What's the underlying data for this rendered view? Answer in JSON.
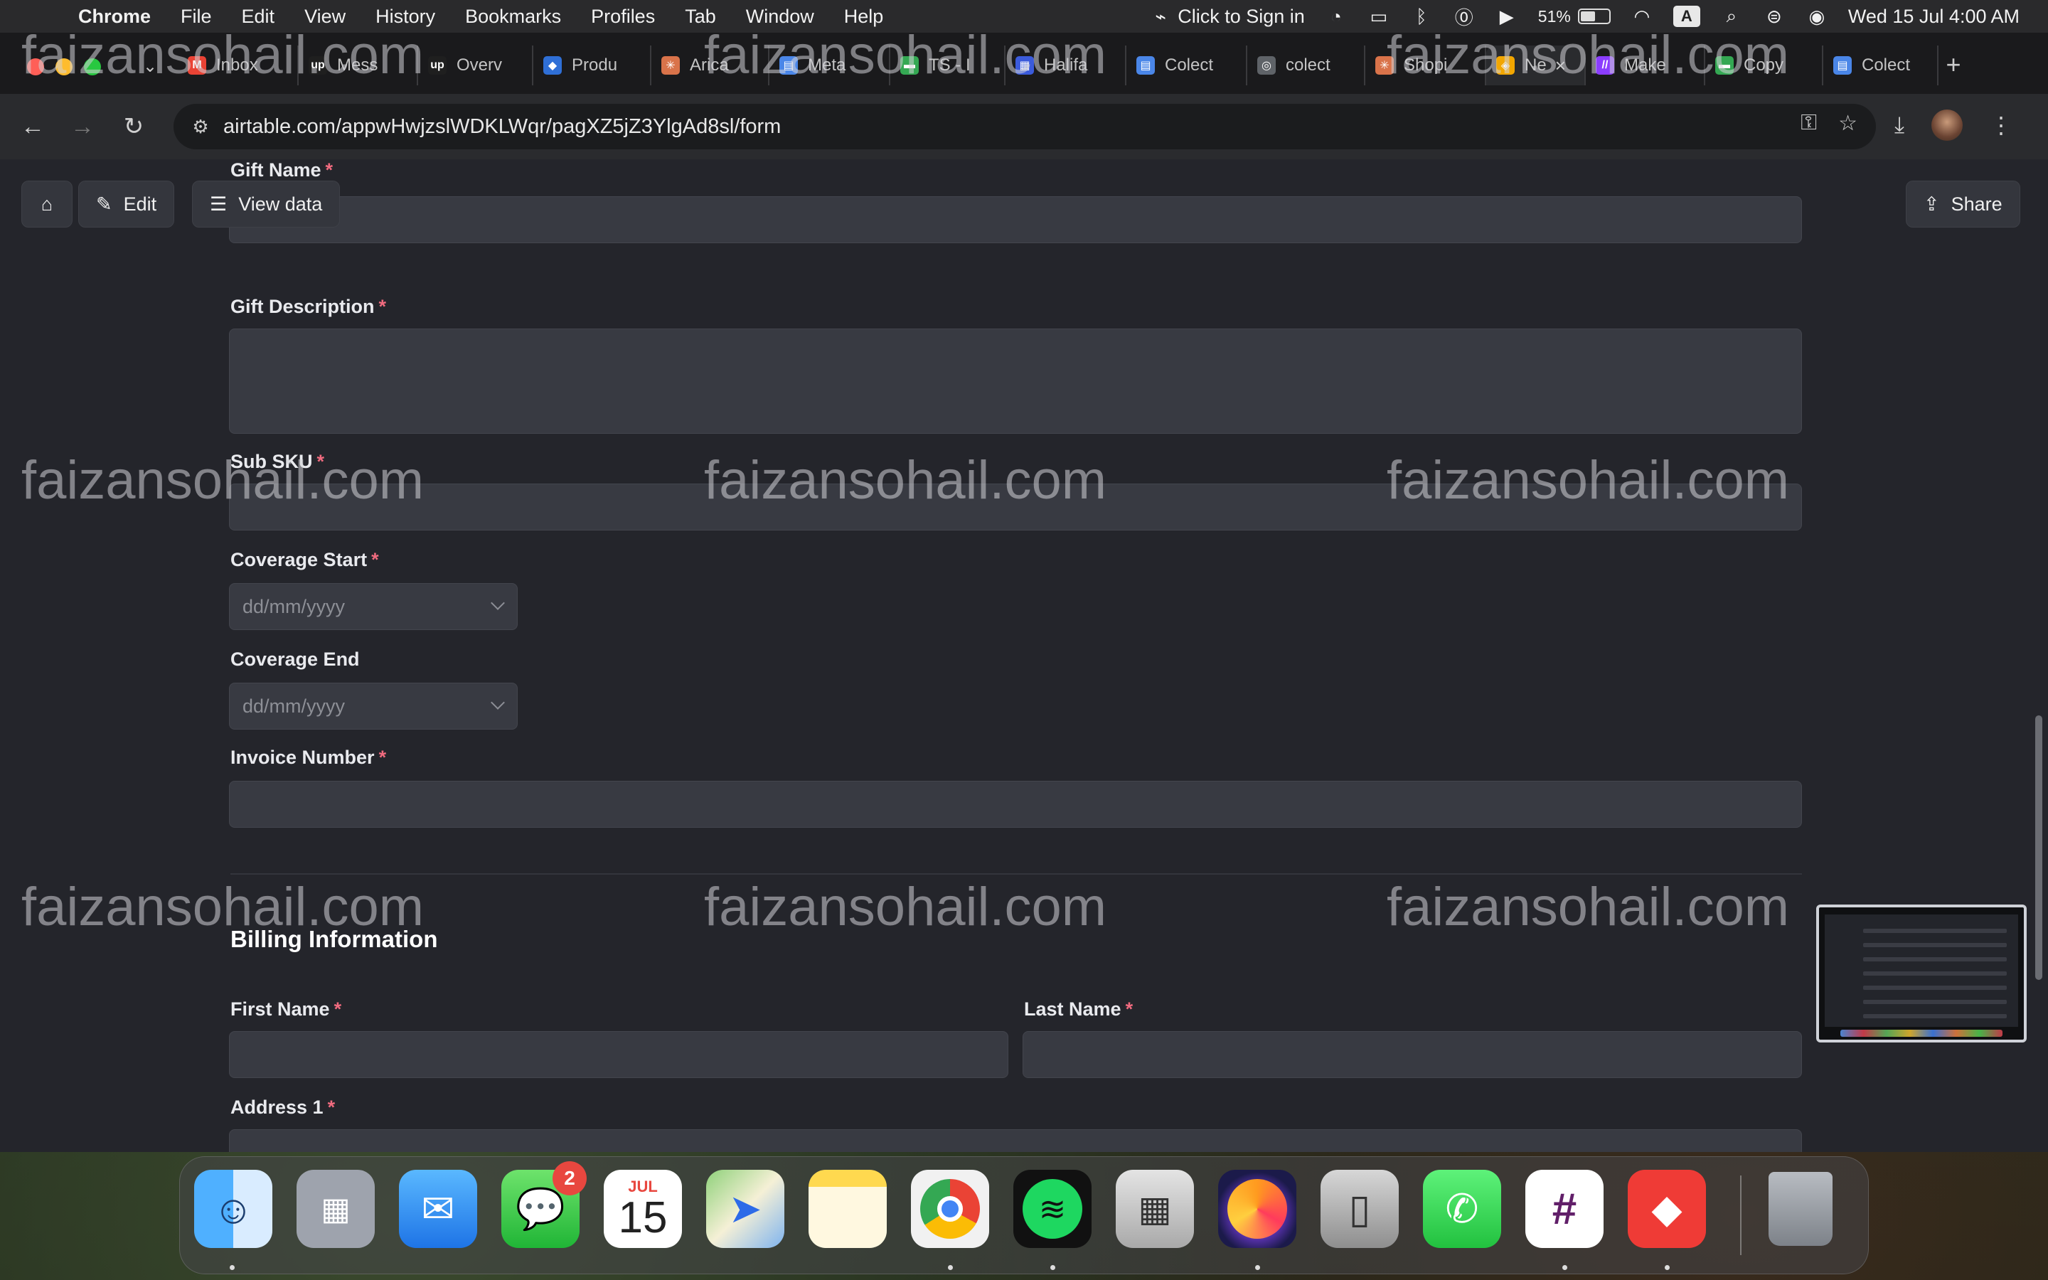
{
  "menubar": {
    "app_name": "Chrome",
    "menus": [
      "File",
      "Edit",
      "View",
      "History",
      "Bookmarks",
      "Profiles",
      "Tab",
      "Window",
      "Help"
    ],
    "sign_in": "Click to Sign in",
    "battery": "51%",
    "input_source": "A",
    "datetime": "Wed 15 Jul  4:00 AM"
  },
  "browser": {
    "tabs": [
      {
        "label": "Inbox",
        "fav": "M",
        "color": "#ea4335"
      },
      {
        "label": "Mess",
        "fav": "up",
        "color": "#1f1f1f"
      },
      {
        "label": "Overv",
        "fav": "up",
        "color": "#1f1f1f"
      },
      {
        "label": "Produ",
        "fav": "◆",
        "color": "#2f6fd6"
      },
      {
        "label": "Arica",
        "fav": "✳",
        "color": "#d9734a"
      },
      {
        "label": "Meta",
        "fav": "▤",
        "color": "#4a86e8"
      },
      {
        "label": "TS - I",
        "fav": "▬",
        "color": "#34a853"
      },
      {
        "label": "Halifa",
        "fav": "▦",
        "color": "#3b5bdb"
      },
      {
        "label": "Colect",
        "fav": "▤",
        "color": "#4a86e8"
      },
      {
        "label": "colect",
        "fav": "◎",
        "color": "#5f6368"
      },
      {
        "label": "Shopi",
        "fav": "✳",
        "color": "#d9734a"
      },
      {
        "label": "Ne",
        "fav": "◈",
        "color": "#f2a600"
      },
      {
        "label": "Make",
        "fav": "//",
        "color": "#8b3dff"
      },
      {
        "label": "Copy",
        "fav": "▬",
        "color": "#34a853"
      },
      {
        "label": "Colect",
        "fav": "▤",
        "color": "#4a86e8"
      }
    ],
    "active_tab_index": 11,
    "url": "airtable.com/appwHwjzslWDKLWqr/pagXZ5jZ3YlgAd8sl/form"
  },
  "form": {
    "toolbar": {
      "edit_label": "Edit",
      "view_data_label": "View data",
      "share_label": "Share"
    },
    "fields": {
      "gift_name": {
        "label": "Gift Name",
        "required": "*"
      },
      "gift_description": {
        "label": "Gift Description",
        "required": "*"
      },
      "sub_sku": {
        "label": "Sub SKU",
        "required": "*"
      },
      "coverage_start": {
        "label": "Coverage Start",
        "required": "*",
        "placeholder": "dd/mm/yyyy"
      },
      "coverage_end": {
        "label": "Coverage End",
        "placeholder": "dd/mm/yyyy"
      },
      "invoice_number": {
        "label": "Invoice Number",
        "required": "*"
      }
    },
    "billing": {
      "title": "Billing Information",
      "first_name": {
        "label": "First Name",
        "required": "*"
      },
      "last_name": {
        "label": "Last Name",
        "required": "*"
      },
      "address_1": {
        "label": "Address 1",
        "required": "*"
      }
    }
  },
  "watermark": "faizansohail.com",
  "dock": {
    "calendar_month": "JUL",
    "calendar_day": "15",
    "messages_badge": "2"
  }
}
